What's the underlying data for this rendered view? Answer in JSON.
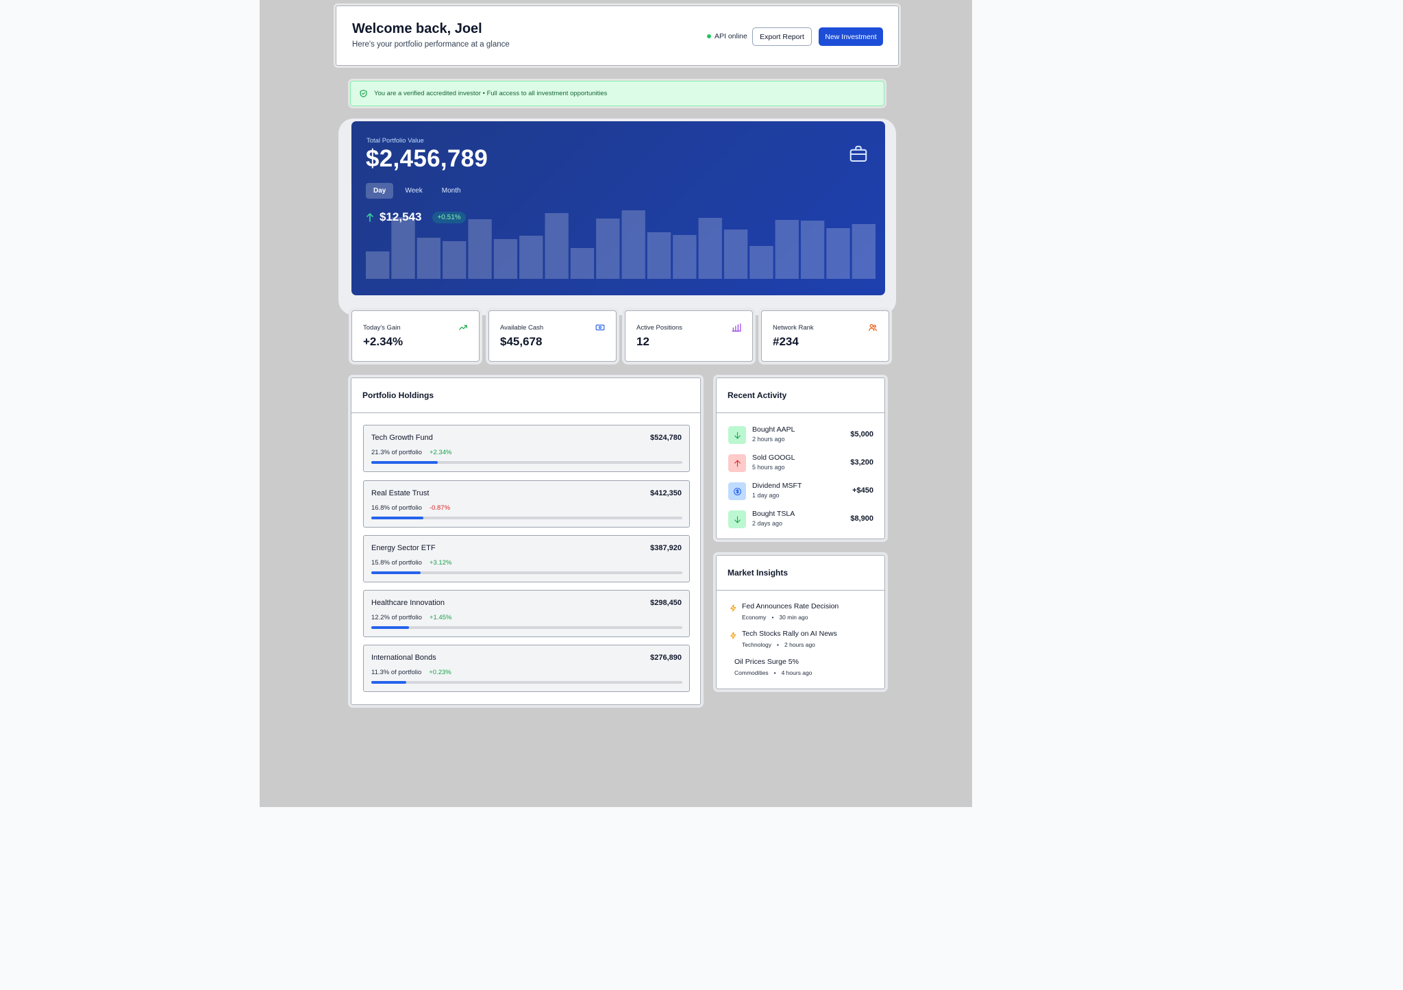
{
  "header": {
    "welcome": "Welcome back, Joel",
    "subtitle": "Here's your portfolio performance at a glance",
    "api_status": "API online",
    "export_label": "Export Report",
    "new_investment_label": "New Investment"
  },
  "banner": {
    "text": "You are a verified accredited investor • Full access to all investment opportunities"
  },
  "portfolio": {
    "label": "Total Portfolio Value",
    "value": "$2,456,789",
    "tabs": [
      {
        "label": "Day",
        "active": true
      },
      {
        "label": "Week",
        "active": false
      },
      {
        "label": "Month",
        "active": false
      }
    ],
    "change_amount": "$12,543",
    "change_percent": "+0.51%",
    "bar_levels": [
      0.4,
      0.9,
      0.6,
      0.55,
      0.87,
      0.58,
      0.63,
      0.96,
      0.45,
      0.88,
      1.0,
      0.68,
      0.64,
      0.89,
      0.72,
      0.48,
      0.86,
      0.85,
      0.74,
      0.8
    ]
  },
  "stats": [
    {
      "label": "Today's Gain",
      "value": "+2.34%",
      "icon": "trending-up-icon",
      "color": "#16a34a"
    },
    {
      "label": "Available Cash",
      "value": "$45,678",
      "icon": "cash-icon",
      "color": "#2563eb"
    },
    {
      "label": "Active Positions",
      "value": "12",
      "icon": "bar-chart-icon",
      "color": "#9333ea"
    },
    {
      "label": "Network Rank",
      "value": "#234",
      "icon": "users-icon",
      "color": "#ea580c"
    }
  ],
  "holdings": {
    "title": "Portfolio Holdings",
    "items": [
      {
        "name": "Tech Growth Fund",
        "value": "$524,780",
        "share": "21.3% of portfolio",
        "change": "+2.34%",
        "positive": true,
        "progress": 0.213
      },
      {
        "name": "Real Estate Trust",
        "value": "$412,350",
        "share": "16.8% of portfolio",
        "change": "-0.87%",
        "positive": false,
        "progress": 0.168
      },
      {
        "name": "Energy Sector ETF",
        "value": "$387,920",
        "share": "15.8% of portfolio",
        "change": "+3.12%",
        "positive": true,
        "progress": 0.158
      },
      {
        "name": "Healthcare Innovation",
        "value": "$298,450",
        "share": "12.2% of portfolio",
        "change": "+1.45%",
        "positive": true,
        "progress": 0.122
      },
      {
        "name": "International Bonds",
        "value": "$276,890",
        "share": "11.3% of portfolio",
        "change": "+0.23%",
        "positive": true,
        "progress": 0.113
      }
    ]
  },
  "activity": {
    "title": "Recent Activity",
    "items": [
      {
        "title": "Bought AAPL",
        "time": "2 hours ago",
        "amount": "$5,000",
        "icon": "arrow-down-icon"
      },
      {
        "title": "Sold GOOGL",
        "time": "5 hours ago",
        "amount": "$3,200",
        "icon": "arrow-up-icon"
      },
      {
        "title": "Dividend MSFT",
        "time": "1 day ago",
        "amount": "+$450",
        "icon": "dollar-icon"
      },
      {
        "title": "Bought TSLA",
        "time": "2 days ago",
        "amount": "$8,900",
        "icon": "arrow-down-icon"
      }
    ]
  },
  "insights": {
    "title": "Market Insights",
    "items": [
      {
        "title": "Fed Announces Rate Decision",
        "category": "Economy",
        "time": "30 min ago",
        "icon": "lightning-icon"
      },
      {
        "title": "Tech Stocks Rally on AI News",
        "category": "Technology",
        "time": "2 hours ago",
        "icon": "lightning-icon"
      },
      {
        "title": "Oil Prices Surge 5%",
        "category": "Commodities",
        "time": "4 hours ago",
        "icon": ""
      }
    ]
  },
  "colors": {
    "accent": "#1d4ed8",
    "hero_bg": "#1e40af",
    "positive": "#16a34a",
    "negative": "#dc2626",
    "banner_bg": "#dcfce7"
  }
}
